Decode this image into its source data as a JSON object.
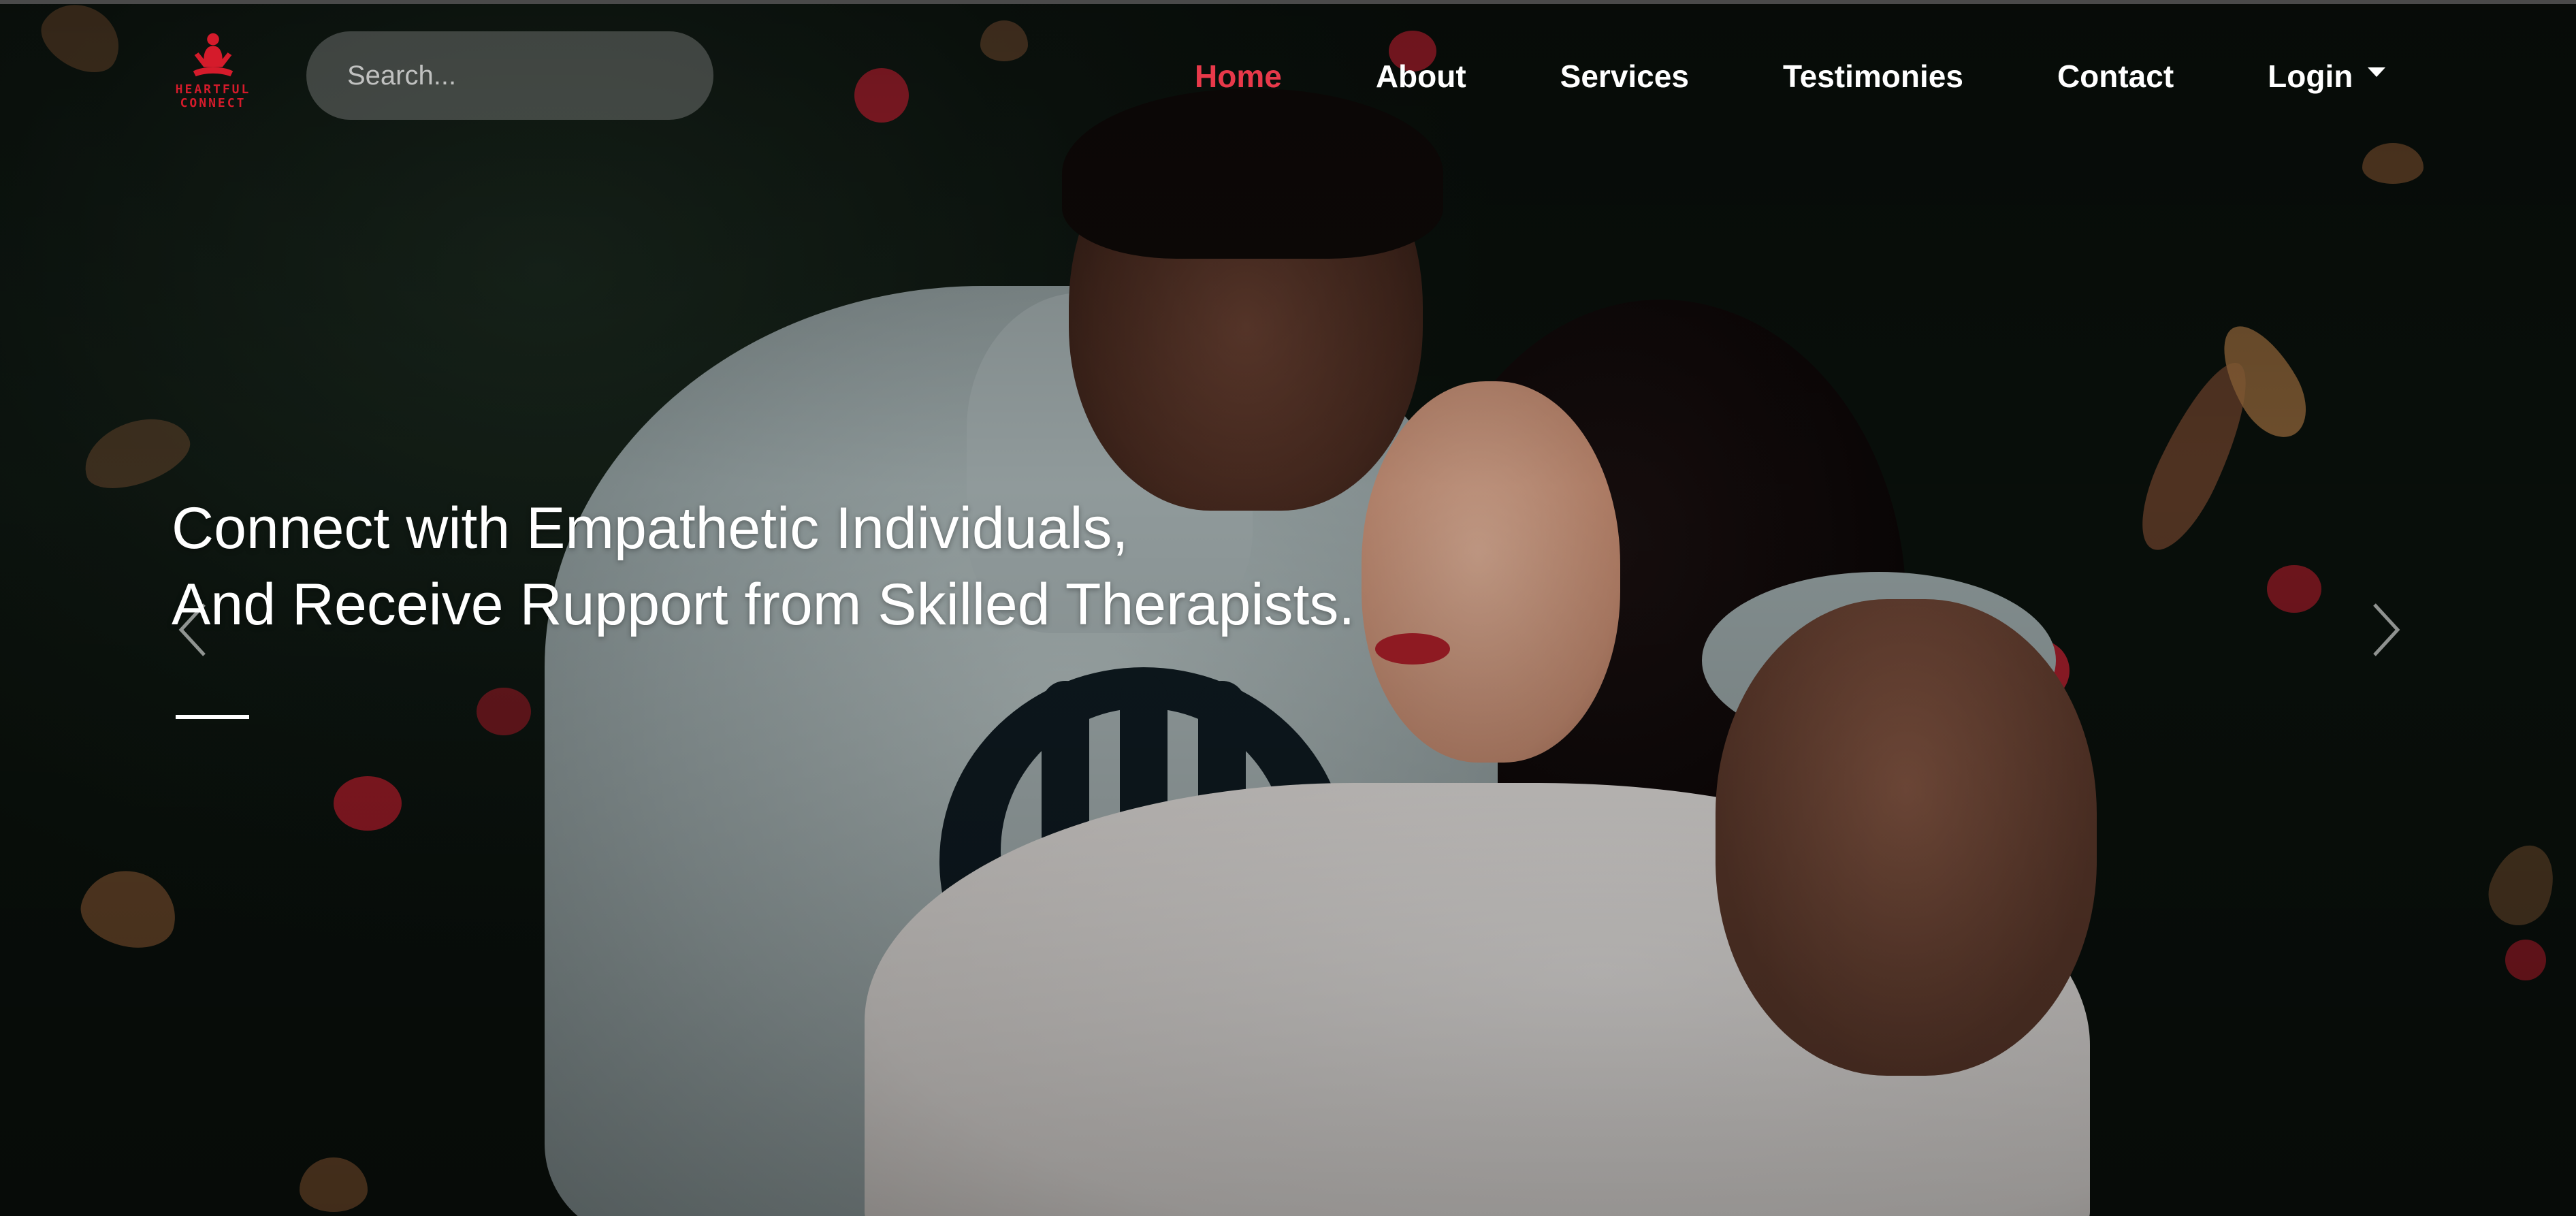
{
  "brand": {
    "logo_text_line1": "HEARTFUL",
    "logo_text_line2": "CONNECT",
    "accent_color": "#d51b2b"
  },
  "search": {
    "placeholder": "Search...",
    "icon": "search-icon"
  },
  "nav": {
    "items": [
      {
        "label": "Home",
        "active": true
      },
      {
        "label": "About",
        "active": false
      },
      {
        "label": "Services",
        "active": false
      },
      {
        "label": "Testimonies",
        "active": false
      },
      {
        "label": "Contact",
        "active": false
      },
      {
        "label": "Login",
        "active": false,
        "dropdown": true
      }
    ],
    "active_color": "#e8394a"
  },
  "hero": {
    "headline_line1": "Connect with Empathetic Individuals,",
    "headline_line2": "And Receive Rupport from Skilled Therapists.",
    "prev_icon": "chevron-left-icon",
    "next_icon": "chevron-right-icon",
    "background_image": "couple-lying-on-grass-photo"
  }
}
